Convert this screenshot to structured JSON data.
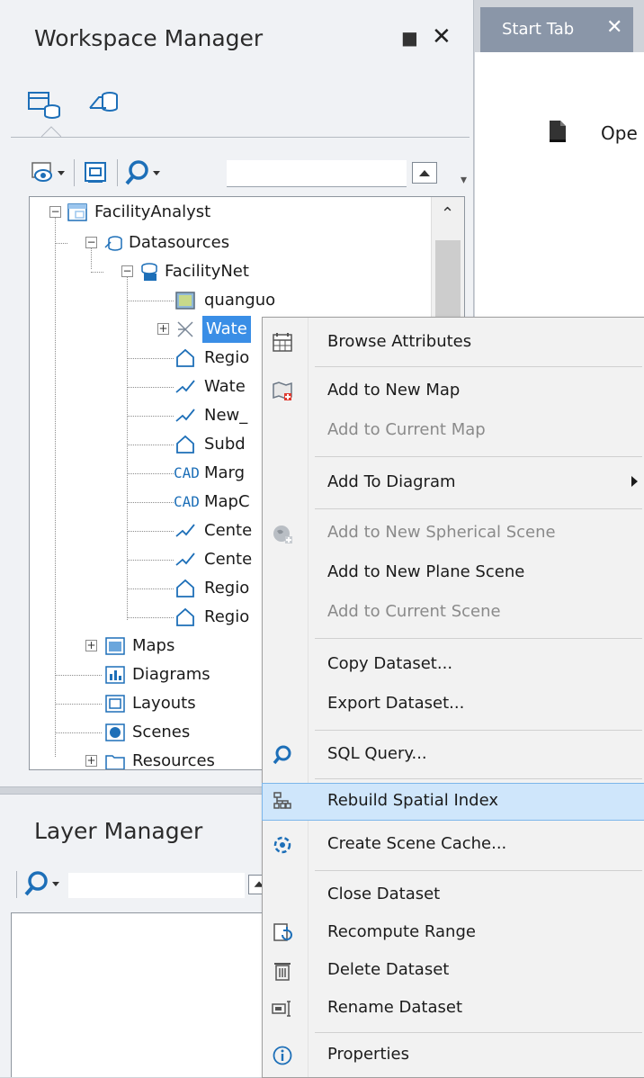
{
  "workspace_manager": {
    "title": "Workspace Manager",
    "tree": {
      "root": "FacilityAnalyst",
      "datasources_label": "Datasources",
      "datasource": "FacilityNet",
      "datasets": [
        {
          "label": "quanguo",
          "icon": "image-dataset-icon"
        },
        {
          "label": "Wate",
          "icon": "network-dataset-icon",
          "selected": true
        },
        {
          "label": "Regio",
          "icon": "region-dataset-icon"
        },
        {
          "label": "Wate",
          "icon": "line-dataset-icon"
        },
        {
          "label": "New_",
          "icon": "line-dataset-icon"
        },
        {
          "label": "Subd",
          "icon": "region-dataset-icon"
        },
        {
          "label": "Marg",
          "icon": "cad-dataset-icon"
        },
        {
          "label": "MapC",
          "icon": "cad-dataset-icon"
        },
        {
          "label": "Cente",
          "icon": "line-dataset-icon"
        },
        {
          "label": "Cente",
          "icon": "line-dataset-icon"
        },
        {
          "label": "Regio",
          "icon": "region-dataset-icon"
        },
        {
          "label": "Regio",
          "icon": "region-dataset-icon"
        }
      ],
      "groups": [
        {
          "label": "Maps",
          "expandable": true
        },
        {
          "label": "Diagrams",
          "expandable": false
        },
        {
          "label": "Layouts",
          "expandable": false
        },
        {
          "label": "Scenes",
          "expandable": false
        },
        {
          "label": "Resources",
          "expandable": true
        }
      ],
      "cad_glyph": "CAD"
    }
  },
  "start_tab": {
    "label": "Start Tab",
    "close_glyph": "✕",
    "open_label": "Ope"
  },
  "layer_manager": {
    "title": "Layer Manager"
  },
  "context_menu": {
    "items": [
      {
        "label": "Browse Attributes",
        "icon": "attribute-table-icon",
        "enabled": true
      },
      {
        "label": "Add to New Map",
        "icon": "add-map-icon",
        "enabled": true
      },
      {
        "label": "Add to Current Map",
        "enabled": false
      },
      {
        "label": "Add To Diagram",
        "enabled": true,
        "submenu": true
      },
      {
        "label": "Add to New Spherical Scene",
        "icon": "globe-icon",
        "enabled": false
      },
      {
        "label": "Add to New Plane Scene",
        "enabled": true
      },
      {
        "label": "Add to Current Scene",
        "enabled": false
      },
      {
        "label": "Copy Dataset...",
        "enabled": true
      },
      {
        "label": "Export Dataset...",
        "enabled": true
      },
      {
        "label": "SQL Query...",
        "icon": "search-icon",
        "enabled": true
      },
      {
        "label": "Rebuild Spatial Index",
        "icon": "spatial-index-icon",
        "enabled": true,
        "highlighted": true
      },
      {
        "label": "Create Scene Cache...",
        "icon": "cache-icon",
        "enabled": true
      },
      {
        "label": "Close Dataset",
        "enabled": true
      },
      {
        "label": "Recompute Range",
        "icon": "recompute-icon",
        "enabled": true
      },
      {
        "label": "Delete Dataset",
        "icon": "delete-icon",
        "enabled": true
      },
      {
        "label": "Rename Dataset",
        "icon": "rename-icon",
        "enabled": true
      },
      {
        "label": "Properties",
        "icon": "info-icon",
        "enabled": true
      }
    ]
  },
  "colors": {
    "selection": "#3a8ee6",
    "menu_highlight": "#cfe6fb",
    "tab": "#8a96a8",
    "panel_bg": "#f0f2f5"
  }
}
